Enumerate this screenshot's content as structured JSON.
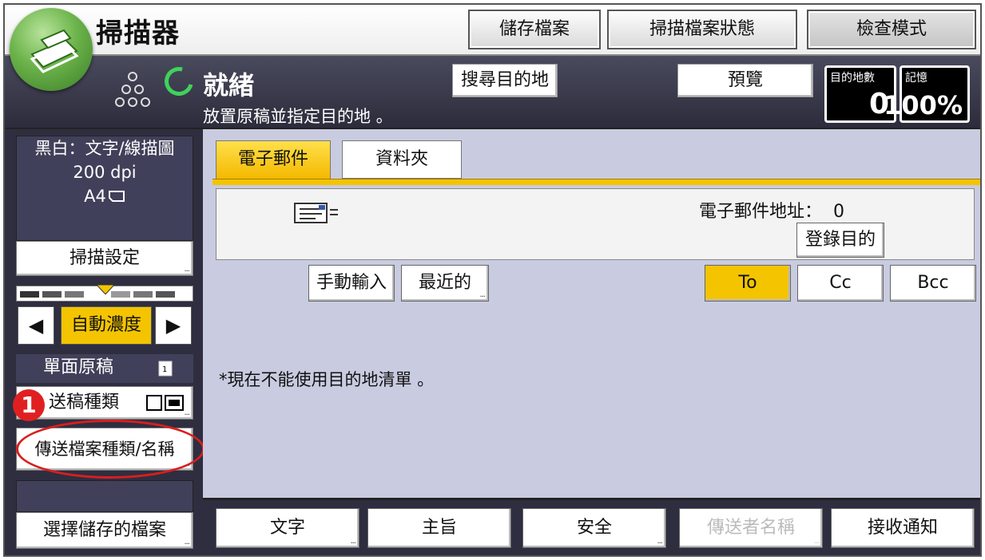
{
  "titlebar": {
    "title": "掃描器",
    "buttons": {
      "save_file": "儲存檔案",
      "scan_file_status": "掃描檔案狀態",
      "check_mode": "檢查模式"
    }
  },
  "status": {
    "title": "就緒",
    "message": "放置原稿並指定目的地 。",
    "search_dest": "搜尋目的地",
    "preview": "預覽",
    "dest_count_label": "目的地數",
    "dest_count": "0",
    "memory_label": "記憶",
    "memory_value": "100%",
    "ready_color": "#3fd25a"
  },
  "left": {
    "scan_info": {
      "mode": "黑白：文字/線描圖",
      "resolution": "200 dpi",
      "size": "A4"
    },
    "scan_settings": "掃描設定",
    "density": {
      "label": "自動濃度",
      "left_arrow": "◀",
      "right_arrow": "▶"
    },
    "simplex": "單面原稿",
    "feed_type": "送稿種類",
    "send_file_type": "傳送檔案種類/名稱",
    "select_stored": "選擇儲存的檔案",
    "badge": "1",
    "highlight_color": "#d91e1e"
  },
  "main": {
    "tabs": [
      {
        "label": "電子郵件"
      },
      {
        "label": "資料夾"
      }
    ],
    "email_address_label": "電子郵件地址：",
    "email_address_count": "0",
    "register_dest": "登錄目的",
    "manual_input": "手動輸入",
    "recent": "最近的",
    "to": "To",
    "cc": "Cc",
    "bcc": "Bcc",
    "notice": "*現在不能使用目的地清單 。",
    "accent_color": "#f4c400"
  },
  "bottom": {
    "text": "文字",
    "subject": "主旨",
    "security": "安全",
    "sender_name": "傳送者名稱",
    "receive_notice": "接收通知"
  }
}
